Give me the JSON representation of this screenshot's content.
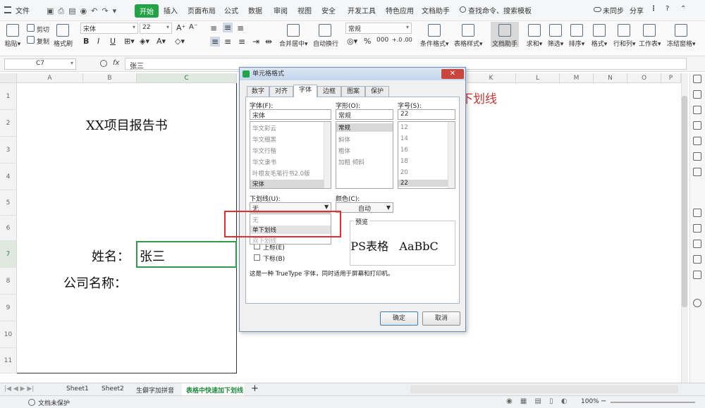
{
  "menubar": {
    "file": "文件",
    "tabs": [
      "开始",
      "插入",
      "页面布局",
      "公式",
      "数据",
      "审阅",
      "视图",
      "安全",
      "开发工具",
      "特色应用",
      "文档助手"
    ],
    "search": "查找命令、搜索模板",
    "sync": "未同步",
    "share": "分享"
  },
  "ribbon": {
    "paste": "粘贴",
    "cut": "剪切",
    "copy": "复制",
    "format_painter": "格式刷",
    "font_name": "宋体",
    "font_size": "22",
    "merge": "合并居中",
    "wrap": "自动换行",
    "number_format": "常规",
    "conditional": "条件格式",
    "table_style": "表格样式",
    "doc_helper": "文档助手",
    "sum": "求和",
    "filter": "筛选",
    "sort": "排序",
    "format": "格式",
    "rowcol": "行和列",
    "worksheet": "工作表",
    "freeze": "冻结窗格"
  },
  "formula_bar": {
    "cell_ref": "C7",
    "fx": "fx",
    "content": "张三"
  },
  "sheet": {
    "columns": [
      "A",
      "B",
      "C",
      "K",
      "L",
      "M",
      "N",
      "O",
      "P"
    ],
    "rows": [
      "1",
      "2",
      "3",
      "4",
      "5",
      "6",
      "7",
      "8",
      "9",
      "10",
      "11"
    ],
    "title": "XX项目报告书",
    "name_label": "姓名：",
    "name_value": "张三",
    "company_label": "公司名称：",
    "overlay_text": "下划线"
  },
  "dialog": {
    "title": "单元格格式",
    "tabs": [
      "数字",
      "对齐",
      "字体",
      "边框",
      "图案",
      "保护"
    ],
    "font_label": "字体(F):",
    "font_value": "宋体",
    "font_list": [
      "华文彩云",
      "华文细黑",
      "华文行楷",
      "华文隶书",
      "叶根友毛笔行书2.0版",
      "宋体"
    ],
    "style_label": "字形(O):",
    "style_value": "常规",
    "style_list": [
      "常规",
      "斜体",
      "粗体",
      "加粗 倾斜"
    ],
    "size_label": "字号(S):",
    "size_value": "22",
    "size_list": [
      "12",
      "14",
      "16",
      "18",
      "20",
      "22"
    ],
    "underline_label": "下划线(U):",
    "underline_value": "无",
    "underline_options": [
      "无",
      "单下划线",
      "双下划线"
    ],
    "color_label": "颜色(C):",
    "color_value": "自动",
    "strike": "上标(E)",
    "subscript": "下标(B)",
    "preview_label": "预览",
    "preview_text": "'PS表格   AaBbC",
    "hint": "这是一种 TrueType 字体，同时适用于屏幕和打印机。",
    "ok": "确定",
    "cancel": "取消"
  },
  "sheet_tabs": [
    "Sheet1",
    "Sheet2",
    "生僻字加拼音",
    "表格中快速加下划线"
  ],
  "status": {
    "protect": "文档未保护",
    "zoom": "100%"
  },
  "colors": {
    "green": "#22a347",
    "red_highlight": "#e03030",
    "red_text": "#d03434"
  }
}
